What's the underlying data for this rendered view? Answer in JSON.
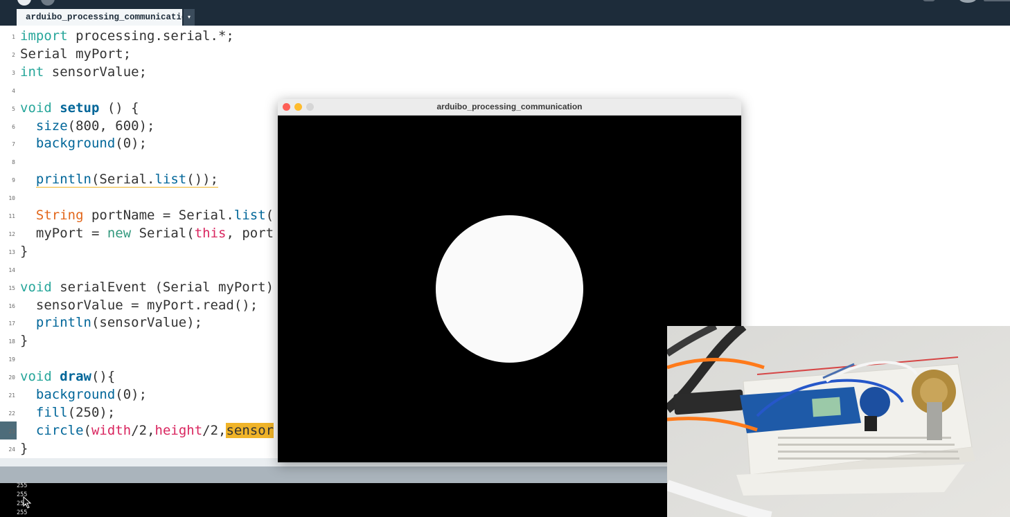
{
  "ide": {
    "tab_label": "arduibo_processing_communication",
    "tab_menu_glyph": "▾"
  },
  "editor": {
    "line_numbers": [
      "1",
      "2",
      "3",
      "4",
      "5",
      "6",
      "7",
      "8",
      "9",
      "10",
      "11",
      "12",
      "13",
      "14",
      "15",
      "16",
      "17",
      "18",
      "19",
      "20",
      "21",
      "22",
      "23",
      "24"
    ],
    "lines": [
      [
        "import",
        " processing.serial.*;"
      ],
      [
        "Serial myPort;"
      ],
      [
        "int",
        " sensorValue;"
      ],
      [
        ""
      ],
      [
        "void",
        " ",
        "setup",
        " () {"
      ],
      [
        "  ",
        "size",
        "(800, 600);"
      ],
      [
        "  ",
        "background",
        "(0);"
      ],
      [
        ""
      ],
      [
        "  ",
        "println",
        "(Serial.",
        "list",
        "());"
      ],
      [
        ""
      ],
      [
        "  ",
        "String",
        " portName = Serial.",
        "list",
        "("
      ],
      [
        "  myPort = ",
        "new",
        " Serial(",
        "this",
        ", port"
      ],
      [
        "}"
      ],
      [
        ""
      ],
      [
        "void",
        " serialEvent (Serial myPort)"
      ],
      [
        "  sensorValue = myPort.read();"
      ],
      [
        "  ",
        "println",
        "(sensorValue);"
      ],
      [
        "}"
      ],
      [
        ""
      ],
      [
        "void",
        " ",
        "draw",
        "(){"
      ],
      [
        "  ",
        "background",
        "(0);"
      ],
      [
        "  ",
        "fill",
        "(250);"
      ],
      [
        "  ",
        "circle",
        "(",
        "width",
        "/2,",
        "height",
        "/2,",
        "sensor"
      ],
      [
        "}"
      ]
    ]
  },
  "console": {
    "lines": [
      "255",
      "255",
      "255",
      "255"
    ]
  },
  "sketch_window": {
    "title": "arduibo_processing_communication",
    "background": "#000000",
    "circle_fill": "#fafafa"
  },
  "colors": {
    "toolbar": "#1d2c3a",
    "keyword": "#26a69a",
    "type": "#e2661a",
    "function": "#006699",
    "highlight": "#f0b429"
  }
}
